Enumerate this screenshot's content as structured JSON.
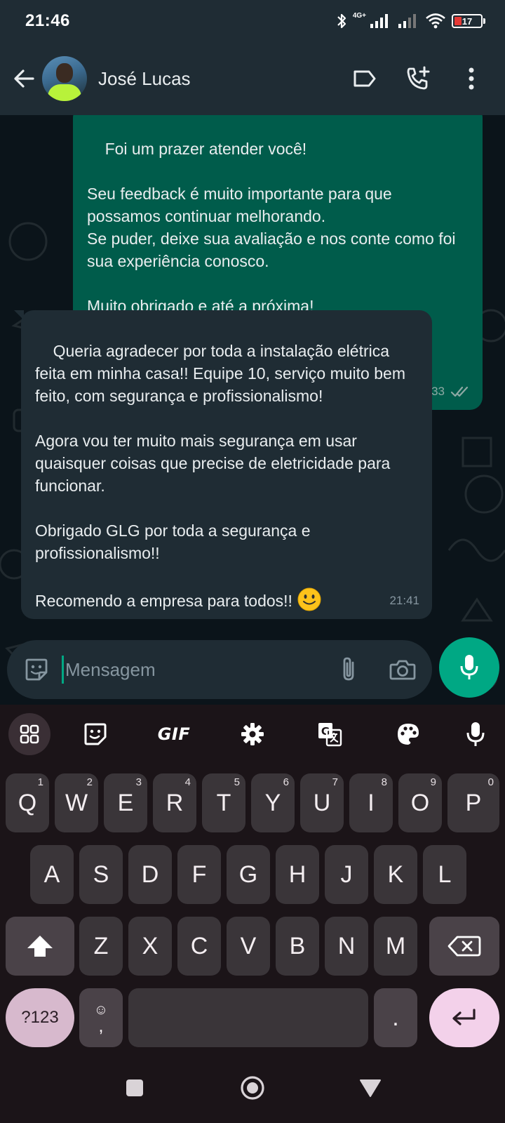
{
  "status_bar": {
    "time": "21:46",
    "network": "4G+",
    "battery": "17"
  },
  "header": {
    "contact_name": "José Lucas",
    "icons": [
      "back-arrow-icon",
      "label-icon",
      "add-call-icon",
      "more-vert-icon"
    ]
  },
  "messages": [
    {
      "direction": "outgoing",
      "text": "Foi um prazer atender você!\n\nSeu feedback é muito importante para que possamos continuar melhorando.\nSe puder, deixe sua avaliação e nos conte como foi sua experiência conosco.\n\nMuito obrigado e até a próxima!",
      "time": "21:33",
      "status": "read"
    },
    {
      "direction": "incoming",
      "text": "Queria agradecer por toda a instalação elétrica feita em minha casa!! Equipe 10, serviço muito bem feito, com segurança e profissionalismo!\n\nAgora vou ter muito mais segurança em usar quaisquer coisas que precise de eletricidade para funcionar.\n\nObrigado GLG por toda a segurança e profissionalismo!!\n\nRecomendo a empresa para todos!!",
      "time": "21:41"
    }
  ],
  "composer": {
    "placeholder": "Mensagem"
  },
  "keyboard": {
    "toolbar": {
      "gif_label": "GIF"
    },
    "rows": [
      [
        "Q",
        "W",
        "E",
        "R",
        "T",
        "Y",
        "U",
        "I",
        "O",
        "P"
      ],
      [
        "A",
        "S",
        "D",
        "F",
        "G",
        "H",
        "J",
        "K",
        "L"
      ],
      [
        "Z",
        "X",
        "C",
        "V",
        "B",
        "N",
        "M"
      ]
    ],
    "number_hints": [
      "1",
      "2",
      "3",
      "4",
      "5",
      "6",
      "7",
      "8",
      "9",
      "0"
    ],
    "symbols_label": "?123",
    "emoji_key_top": "☺",
    "emoji_key_bottom": ",",
    "period_label": "."
  },
  "colors": {
    "outgoing_bubble": "#005c4b",
    "incoming_bubble": "#1f2c34",
    "accent": "#00a884",
    "read_ticks": "#8ea9a4"
  }
}
